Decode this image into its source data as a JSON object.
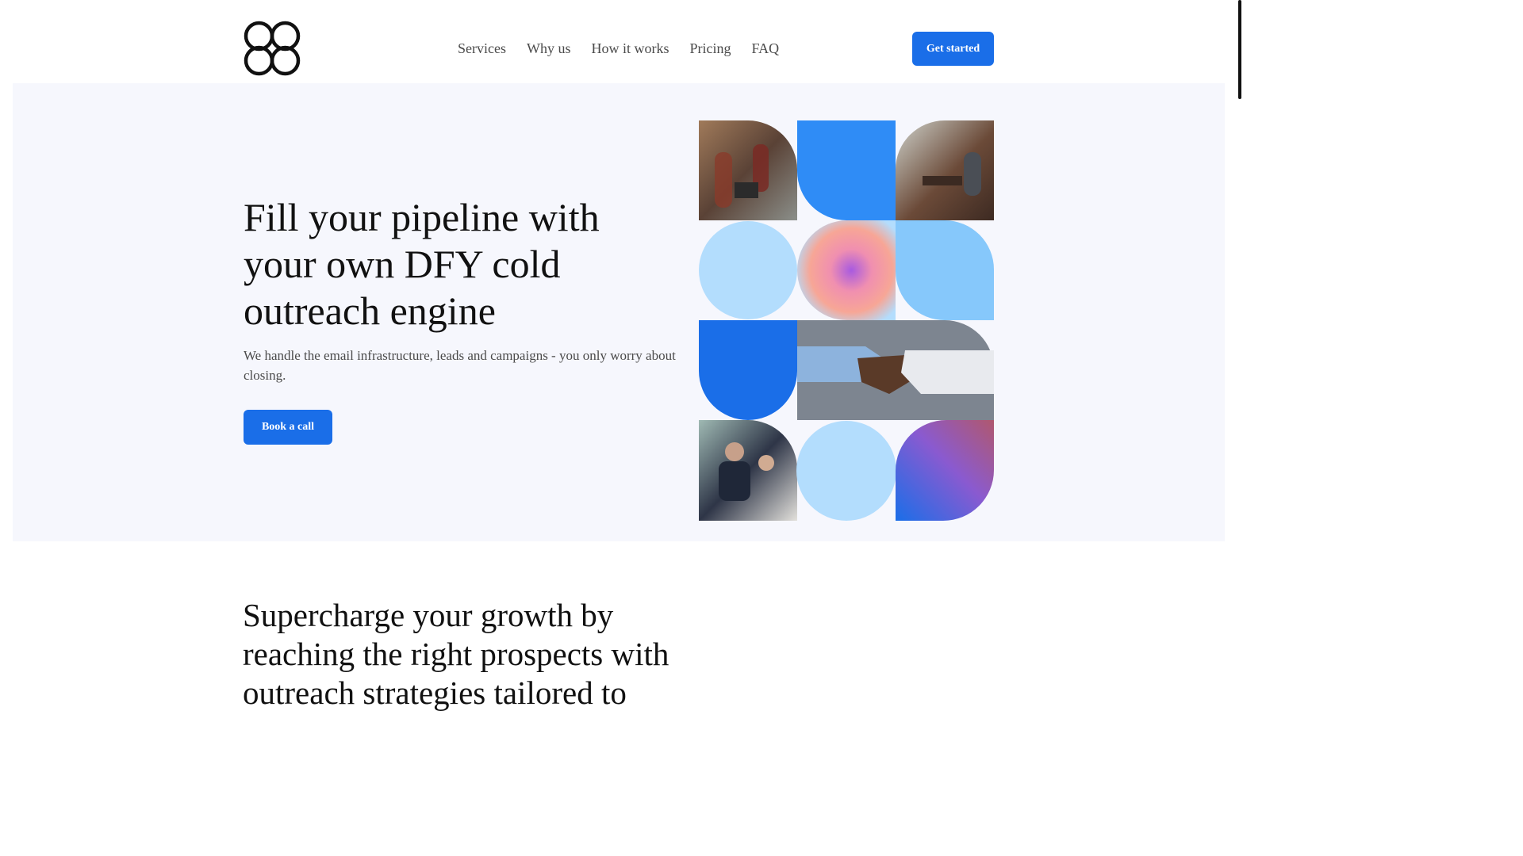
{
  "header": {
    "logo_icon": "four-petal-clover-logo",
    "nav": [
      {
        "label": "Services"
      },
      {
        "label": "Why us"
      },
      {
        "label": "How it works"
      },
      {
        "label": "Pricing"
      },
      {
        "label": "FAQ"
      }
    ],
    "cta_label": "Get started"
  },
  "hero": {
    "title": "Fill your pipeline with your own DFY cold outreach engine",
    "subtitle": "We handle the email infrastructure, leads and campaigns - you only worry about closing.",
    "cta_label": "Book a call",
    "mosaic_tiles": [
      "photo-office-women-tablet",
      "blue-quarter-shape",
      "photo-woman-laptop",
      "light-blue-circle",
      "gradient-blob",
      "light-blue-leaf-shape",
      "blue-drop-shape",
      "photo-handshake",
      "photo-meeting-two-people",
      "light-blue-circle",
      "gradient-purple-leaf"
    ]
  },
  "section2": {
    "title": "Supercharge your growth by reaching the right prospects with outreach strategies tailored to"
  },
  "colors": {
    "accent": "#1a6ee8",
    "hero_background": "#f6f7fd",
    "light_blue": "#b3ddfd",
    "mid_blue": "#2f8cf6",
    "text_dark": "#111111",
    "text_muted": "#4a4a4a"
  }
}
